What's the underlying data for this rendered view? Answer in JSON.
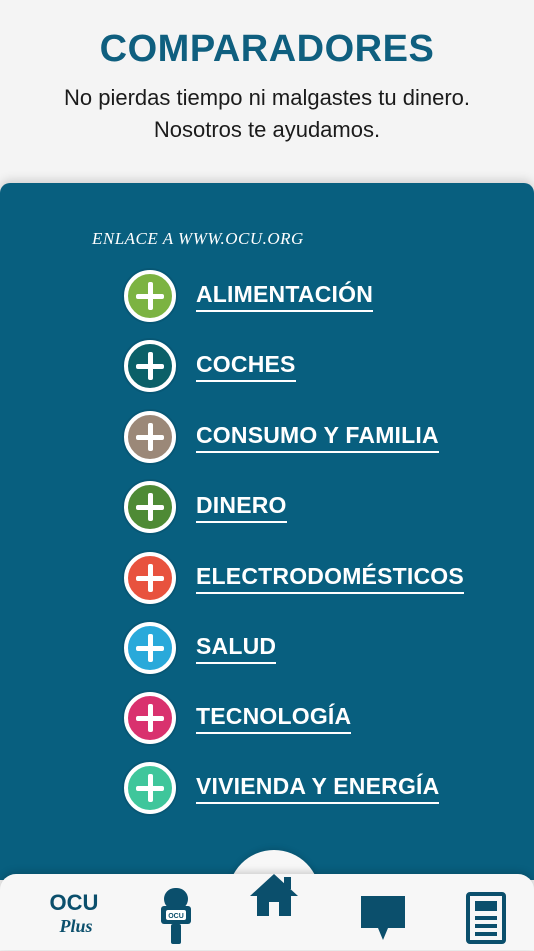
{
  "header": {
    "title": "COMPARADORES",
    "subtitle_line1": "No pierdas tiempo ni malgastes tu dinero.",
    "subtitle_line2": "Nosotros te ayudamos."
  },
  "link_note": "ENLACE A WWW.OCU.ORG",
  "categories": [
    {
      "label": "ALIMENTACIÓN",
      "color": "#7cb342"
    },
    {
      "label": "COCHES",
      "color": "#0b6068"
    },
    {
      "label": "CONSUMO Y FAMILIA",
      "color": "#9b8878"
    },
    {
      "label": "DINERO",
      "color": "#4e8a35"
    },
    {
      "label": "ELECTRODOMÉSTICOS",
      "color": "#e8523e"
    },
    {
      "label": "SALUD",
      "color": "#29a9da"
    },
    {
      "label": "TECNOLOGÍA",
      "color": "#d9316e"
    },
    {
      "label": "VIVIENDA Y ENERGÍA",
      "color": "#3fc69b"
    }
  ],
  "nav": {
    "logo_ocu": "OCU",
    "logo_plus": "Plus",
    "mic_badge": "OCU",
    "icons": [
      "ocu-plus-logo-icon",
      "microphone-icon",
      "home-icon",
      "chat-bubble-icon",
      "newspaper-icon"
    ],
    "icon_color": "#0b4f6c"
  }
}
